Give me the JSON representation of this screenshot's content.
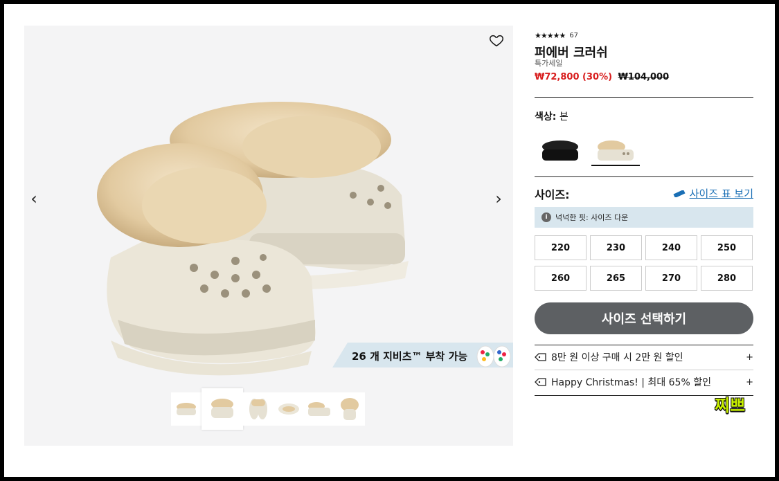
{
  "product": {
    "rating_count": "67",
    "stars": "★★★★★",
    "title": "퍼에버 크러쉬",
    "subtitle": "특가세일",
    "sale_price": "₩72,800 (30%)",
    "original_price": "₩104,000"
  },
  "gallery": {
    "prev_icon": "chevron-left-icon",
    "next_icon": "chevron-right-icon",
    "wishlist_icon": "heart-icon",
    "jibbitz_text": "26 개 지비츠™ 부착 가능",
    "thumbnail_count": 6
  },
  "color": {
    "label": "색상:",
    "value": "본",
    "swatches": [
      "black",
      "bone"
    ]
  },
  "size": {
    "label": "사이즈:",
    "chart_link": "사이즈 표 보기",
    "fit_note": "넉넉한 핏: 사이즈 다운",
    "options": [
      "220",
      "230",
      "240",
      "250",
      "260",
      "265",
      "270",
      "280"
    ],
    "select_button": "사이즈 선택하기"
  },
  "promos": [
    {
      "text": "8만 원 이상 구매 시 2만 원 할인",
      "plus": "+"
    },
    {
      "text": "Happy Christmas! | 최대 65% 할인",
      "plus": "+"
    }
  ],
  "watermark": "찌쁘",
  "colors": {
    "sale": "#d81d1d",
    "link": "#1a6fb5",
    "button": "#5d6063",
    "note_bg": "#d8e6ee"
  }
}
